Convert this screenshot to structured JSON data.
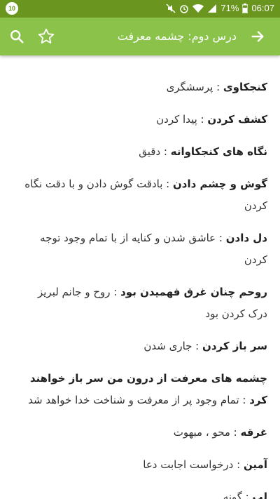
{
  "status_bar": {
    "battery": "71%",
    "time": "06:07",
    "notification_badge": "10"
  },
  "app_bar": {
    "title": "درس دوم: چشمه معرفت",
    "icons": {
      "back": "arrow-forward-icon",
      "search": "search-icon",
      "favorite": "star-outline-icon"
    }
  },
  "entries": [
    {
      "term": "کنجکاوی",
      "definition": " : پرسشگری"
    },
    {
      "term": "کشف کردن",
      "definition": " : پیدا کردن"
    },
    {
      "term": "نگاه های کنجکاوانه",
      "definition": " : دقیق"
    },
    {
      "term": "گوش و چشم دادن",
      "definition": " : بادقت گوش دادن و با دقت نگاه کردن"
    },
    {
      "term": "دل دادن",
      "definition": " : عاشق شدن و کنایه از با تمام وجود توجه کردن"
    },
    {
      "term": "روحم چنان غرق فهمیدن بود",
      "definition": " : روح و جانم لبریز درک کردن بود"
    },
    {
      "term": "سر باز کردن",
      "definition": " : جاری شدن"
    },
    {
      "term": "چشمه های معرفت از درون من سر باز خواهند کرد",
      "definition": " : تمام وجود پر از معرفت و شناخت خدا خواهد شد"
    },
    {
      "term": "غرقه",
      "definition": " : محو ، مبهوت"
    },
    {
      "term": "آمین",
      "definition": " : درخواست اجابت دعا"
    },
    {
      "term": "لپ",
      "definition": " : گونه"
    }
  ],
  "colors": {
    "status_bar": "#6a961f",
    "app_bar": "#8bc34a",
    "text": "#333333"
  }
}
